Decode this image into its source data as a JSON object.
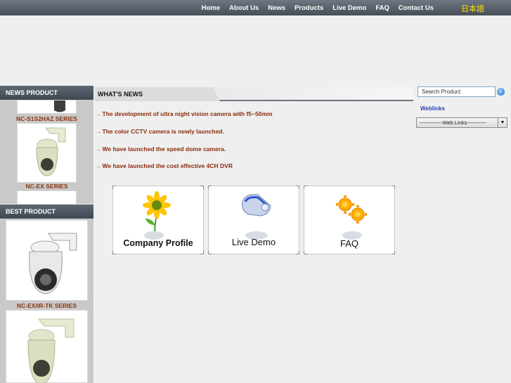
{
  "nav": {
    "items": [
      "Home",
      "About Us",
      "News",
      "Products",
      "Live Demo",
      "FAQ",
      "Contact Us"
    ],
    "language": "日本語"
  },
  "sidebar": {
    "news_product_title": "NEWS PRODUCT",
    "news_products": [
      "NC-S1S2HAZ SERIES",
      "NC-EX SERIES"
    ],
    "best_product_title": "BEST PRODUCT",
    "best_products": [
      "NC-EX/IR-TK SERIES"
    ]
  },
  "whats_news": {
    "title": "WHAT'S NEWS",
    "items": [
      "The development of ultra night vision camera with f5~50mm",
      "The color CCTV camera is newly launched.",
      "We have launched the speed dome camera.",
      "We have launched the cost effective 4CH DVR"
    ]
  },
  "boxes": [
    "Company Profile",
    "Live Demo",
    "FAQ"
  ],
  "right": {
    "search_placeholder": "Search Product",
    "weblinks_label": "Weblinks",
    "weblinks_select": "-------------Web Links-----------"
  },
  "colors": {
    "accent": "#8a2b0c",
    "link": "#2a3fb0",
    "nav_text": "#ffffff",
    "lang": "#ffe000"
  }
}
